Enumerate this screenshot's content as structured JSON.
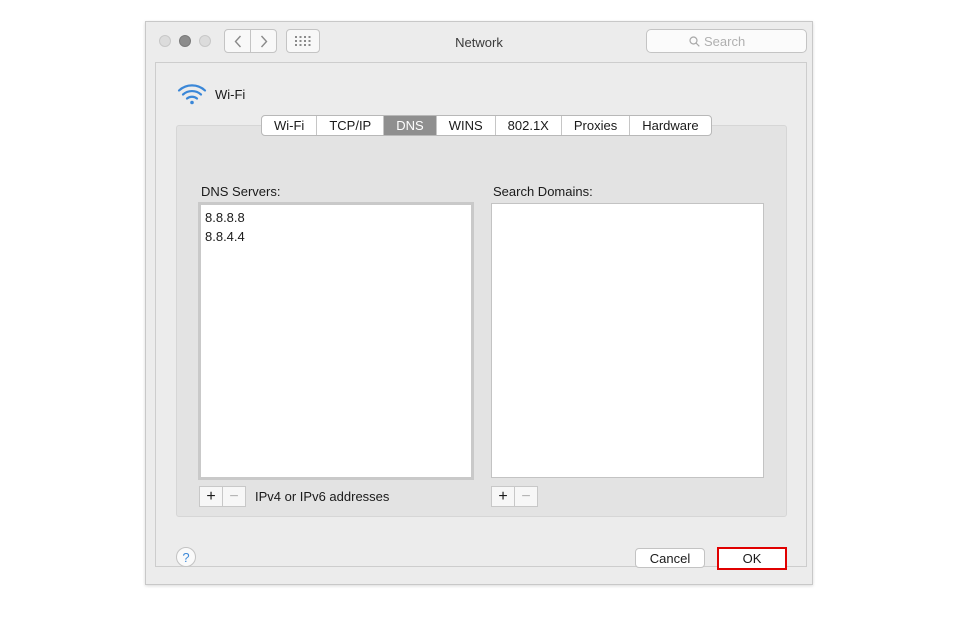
{
  "window": {
    "title": "Network"
  },
  "search": {
    "placeholder": "Search"
  },
  "interface": {
    "name": "Wi-Fi"
  },
  "tabs": [
    {
      "label": "Wi-Fi"
    },
    {
      "label": "TCP/IP"
    },
    {
      "label": "DNS",
      "selected": true
    },
    {
      "label": "WINS"
    },
    {
      "label": "802.1X"
    },
    {
      "label": "Proxies"
    },
    {
      "label": "Hardware"
    }
  ],
  "dns": {
    "servers_label": "DNS Servers:",
    "servers": [
      "8.8.8.8",
      "8.8.4.4"
    ],
    "hint": "IPv4 or IPv6 addresses"
  },
  "domains": {
    "label": "Search Domains:",
    "items": []
  },
  "controls": {
    "plus": "+",
    "minus": "−"
  },
  "footer": {
    "help_label": "?",
    "cancel_label": "Cancel",
    "ok_label": "OK"
  },
  "colors": {
    "wifi_icon": "#3a87d8",
    "selected_tab": "#8f8f8f",
    "ok_highlight": "#e00000"
  },
  "icons": {
    "back": "chevron-left-icon",
    "forward": "chevron-right-icon",
    "show_all": "grid-icon",
    "search": "search-icon",
    "interface": "wifi-icon"
  }
}
